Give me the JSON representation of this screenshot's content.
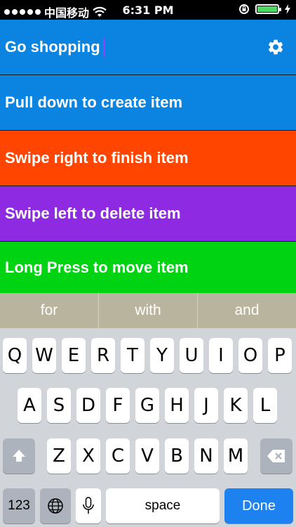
{
  "status_bar": {
    "carrier": "中国移动",
    "time": "6:31 PM"
  },
  "list": {
    "title": "Go shopping",
    "items": [
      {
        "label": "Pull down to create item",
        "color": "#0a84e0"
      },
      {
        "label": "Swipe right to finish item",
        "color": "#ff4500"
      },
      {
        "label": "Swipe left to delete item",
        "color": "#8e2be2"
      },
      {
        "label": "Long Press to move item",
        "color": "#00d312"
      }
    ],
    "colors": {
      "header": "#0a84e0"
    }
  },
  "suggestions": [
    "for",
    "with",
    "and"
  ],
  "keyboard": {
    "row1": [
      "Q",
      "W",
      "E",
      "R",
      "T",
      "Y",
      "U",
      "I",
      "O",
      "P"
    ],
    "row2": [
      "A",
      "S",
      "D",
      "F",
      "G",
      "H",
      "J",
      "K",
      "L"
    ],
    "row3": [
      "Z",
      "X",
      "C",
      "V",
      "B",
      "N",
      "M"
    ],
    "numbers_label": "123",
    "space_label": "space",
    "done_label": "Done",
    "icons": {
      "shift": "shift-icon",
      "delete": "backspace-icon",
      "globe": "globe-icon",
      "mic": "microphone-icon"
    }
  }
}
